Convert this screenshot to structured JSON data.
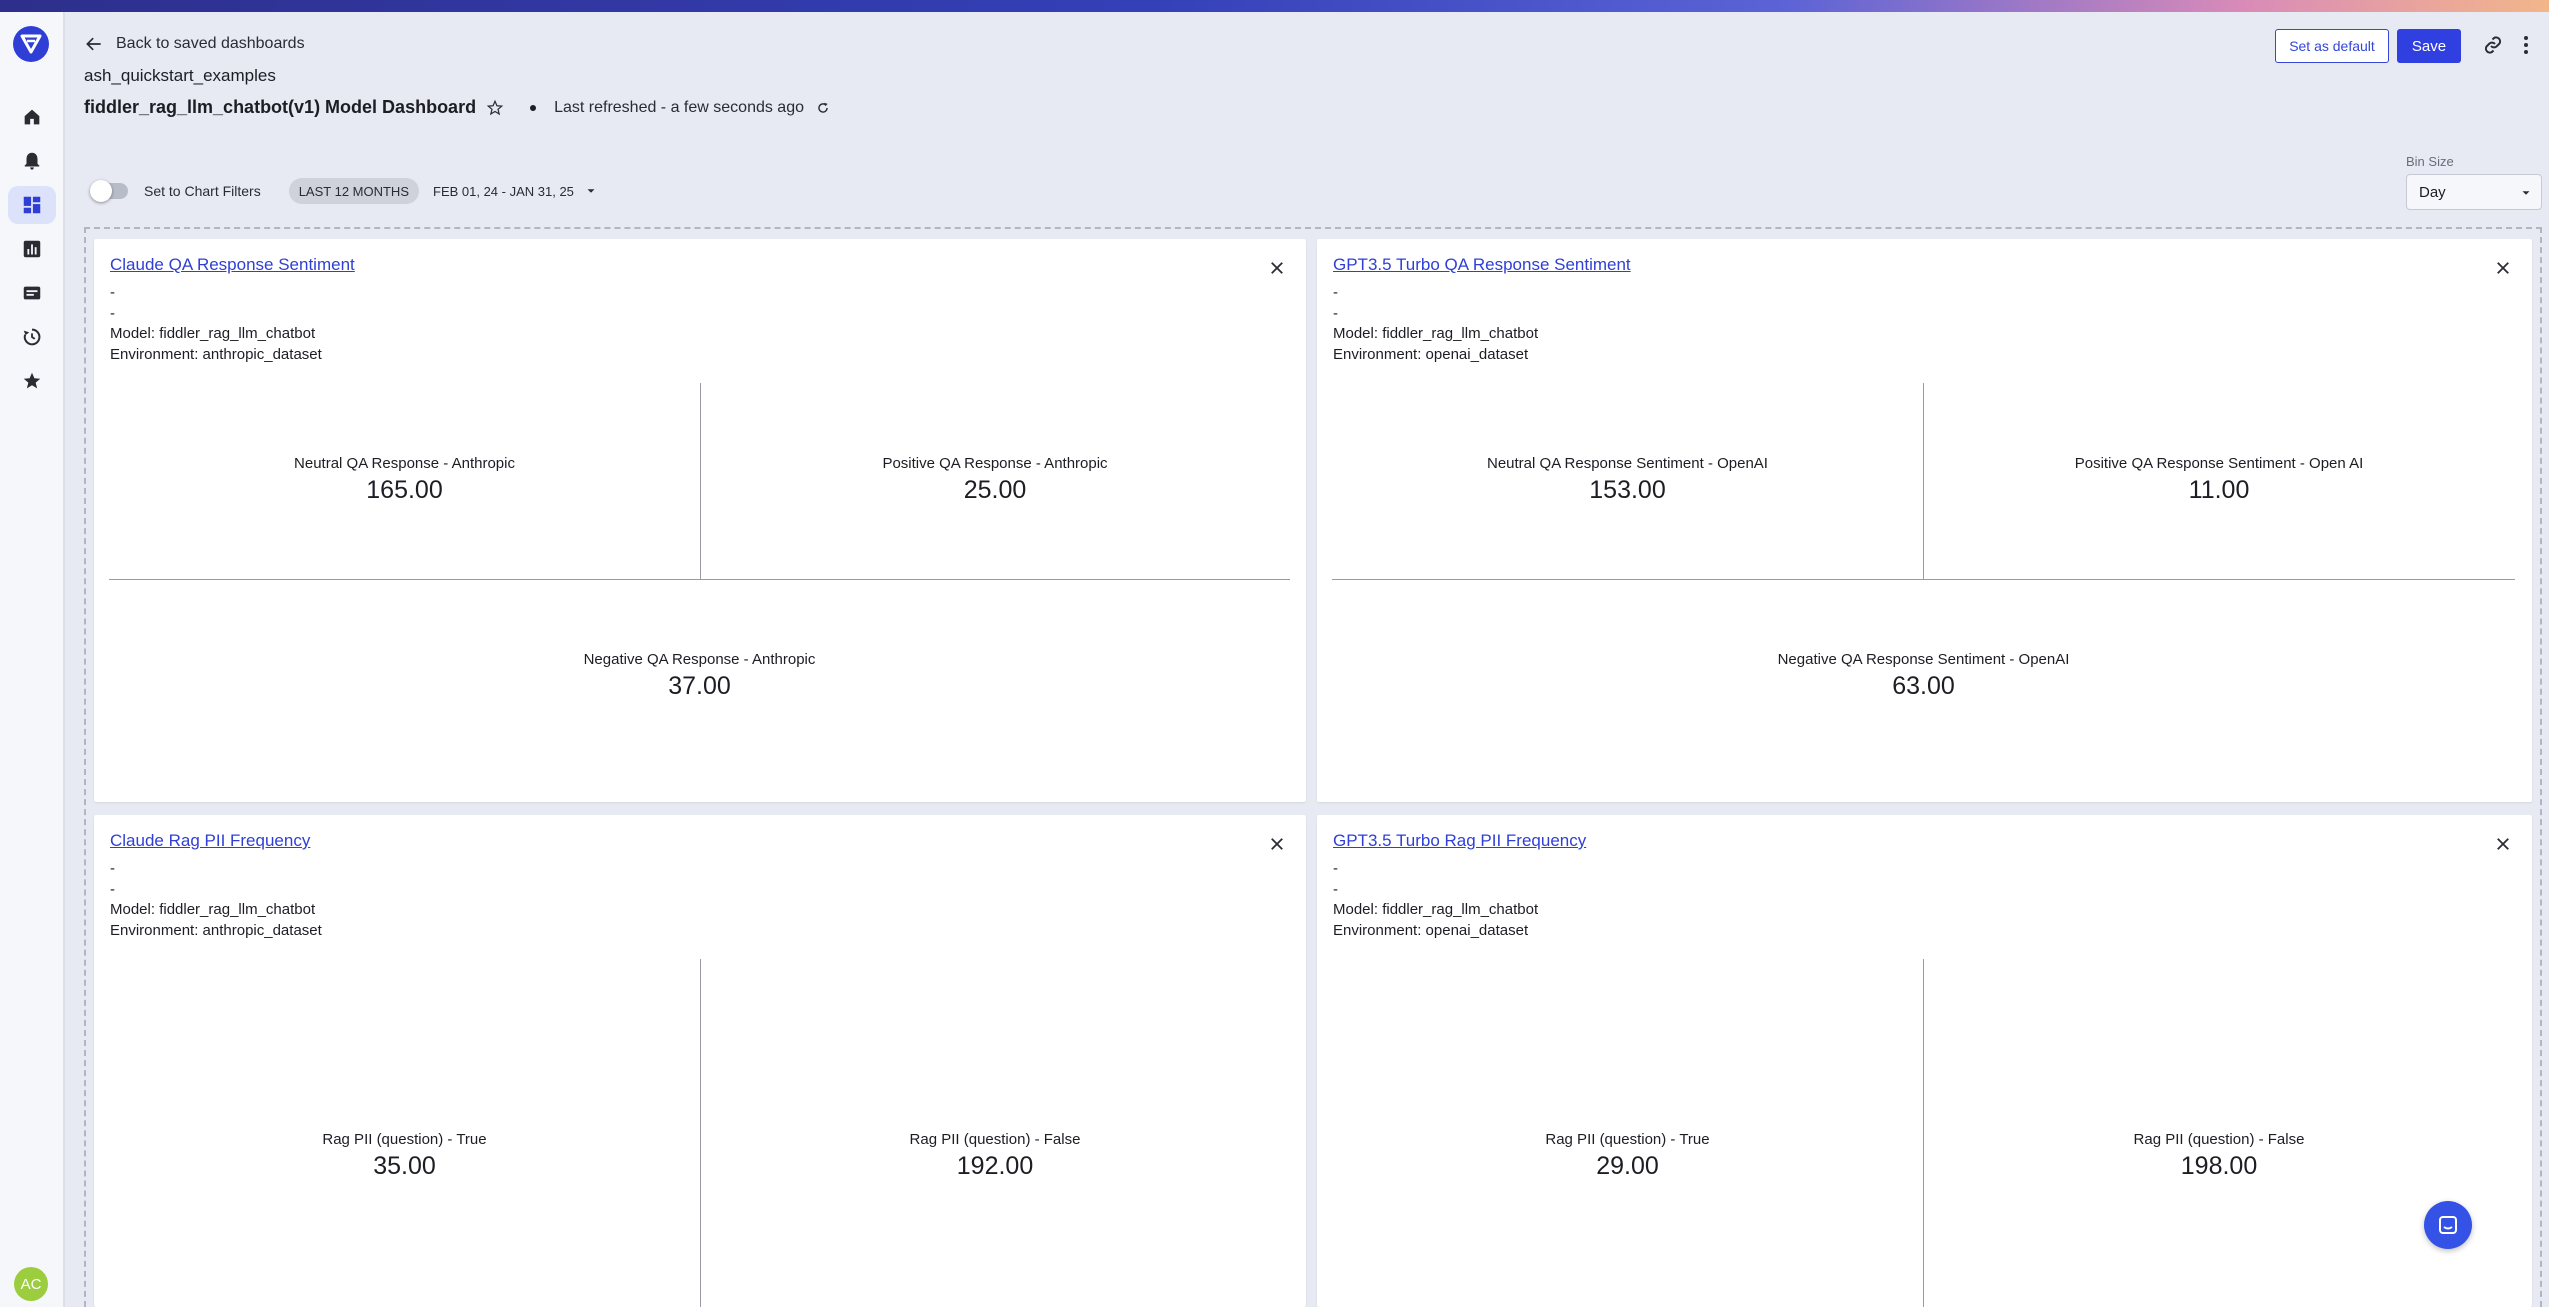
{
  "header": {
    "back_label": "Back to saved dashboards",
    "org_name": "ash_quickstart_examples",
    "dashboard_title": "fiddler_rag_llm_chatbot(v1) Model Dashboard",
    "last_refreshed": "Last refreshed - a few seconds ago",
    "set_default_label": "Set as default",
    "save_label": "Save"
  },
  "filters": {
    "toggle_label": "Set to Chart Filters",
    "range_chip": "LAST 12 MONTHS",
    "range_dates": "FEB 01, 24 - JAN 31, 25",
    "bin_size_label": "Bin Size",
    "bin_size_value": "Day"
  },
  "sidebar": {
    "items": [
      "home-icon",
      "bell-icon",
      "dashboard-icon",
      "chart-icon",
      "folder-icon",
      "history-icon",
      "star-icon"
    ],
    "avatar_initials": "AC"
  },
  "cards": [
    {
      "title": "Claude QA Response Sentiment",
      "line1": "-",
      "line2": "-",
      "model": "Model: fiddler_rag_llm_chatbot",
      "environment": "Environment: anthropic_dataset",
      "metrics": [
        {
          "label": "Neutral QA Response - Anthropic",
          "value": "165.00"
        },
        {
          "label": "Positive QA Response - Anthropic",
          "value": "25.00"
        },
        {
          "label": "Negative QA Response - Anthropic",
          "value": "37.00"
        }
      ]
    },
    {
      "title": "GPT3.5 Turbo QA Response Sentiment",
      "line1": "-",
      "line2": "-",
      "model": "Model: fiddler_rag_llm_chatbot",
      "environment": "Environment: openai_dataset",
      "metrics": [
        {
          "label": "Neutral QA Response Sentiment - OpenAI",
          "value": "153.00"
        },
        {
          "label": "Positive QA Response Sentiment - Open AI",
          "value": "11.00"
        },
        {
          "label": "Negative QA Response Sentiment - OpenAI",
          "value": "63.00"
        }
      ]
    },
    {
      "title": "Claude Rag PII Frequency",
      "line1": "-",
      "line2": "-",
      "model": "Model: fiddler_rag_llm_chatbot",
      "environment": "Environment: anthropic_dataset",
      "metrics": [
        {
          "label": "Rag PII (question) - True",
          "value": "35.00"
        },
        {
          "label": "Rag PII (question) - False",
          "value": "192.00"
        }
      ]
    },
    {
      "title": "GPT3.5 Turbo Rag PII Frequency",
      "line1": "-",
      "line2": "-",
      "model": "Model: fiddler_rag_llm_chatbot",
      "environment": "Environment: openai_dataset",
      "metrics": [
        {
          "label": "Rag PII (question) - True",
          "value": "29.00"
        },
        {
          "label": "Rag PII (question) - False",
          "value": "198.00"
        }
      ]
    }
  ]
}
